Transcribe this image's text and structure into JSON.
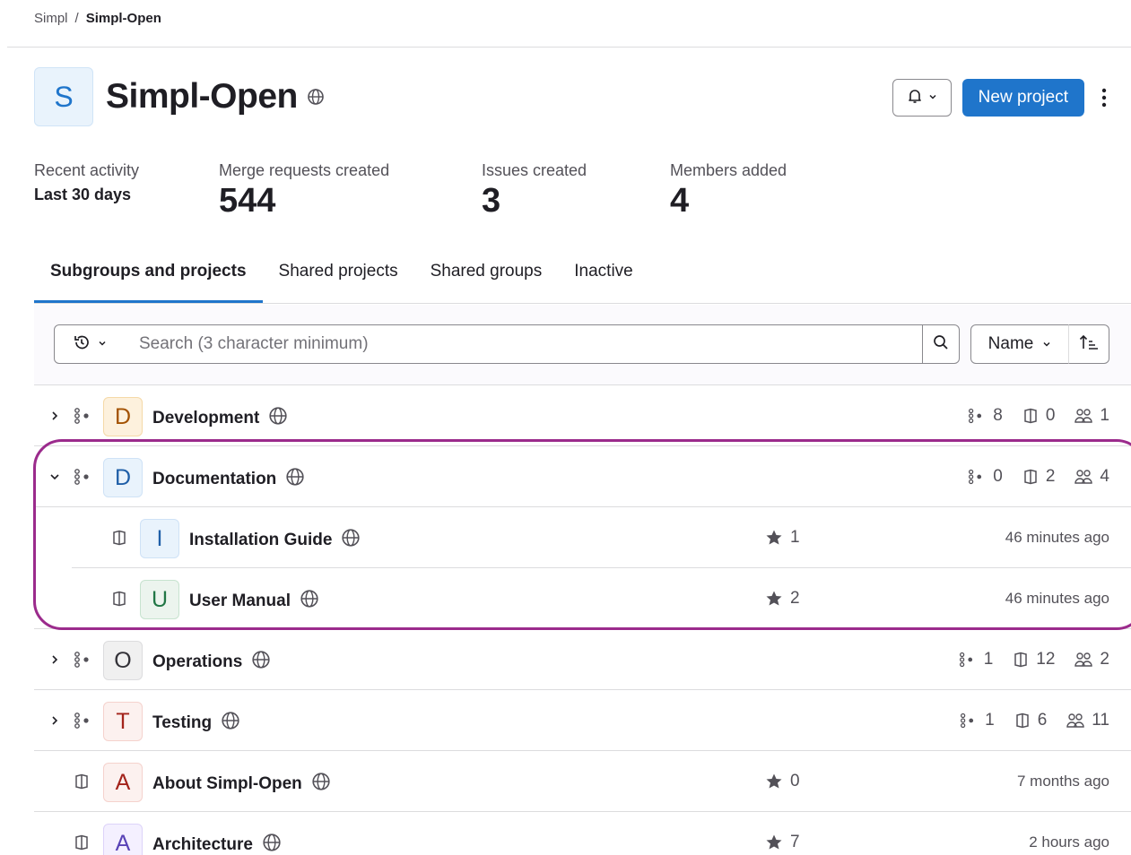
{
  "breadcrumb": {
    "parent": "Simpl",
    "separator": "/",
    "current": "Simpl-Open"
  },
  "group": {
    "avatar_letter": "S",
    "title": "Simpl-Open",
    "visibility_icon": "globe-icon"
  },
  "header_actions": {
    "new_project_label": "New project"
  },
  "stats": {
    "recent_activity_label": "Recent activity",
    "recent_activity_period": "Last 30 days",
    "merge_requests_label": "Merge requests created",
    "merge_requests_value": "544",
    "issues_label": "Issues created",
    "issues_value": "3",
    "members_label": "Members added",
    "members_value": "4"
  },
  "tabs": [
    {
      "label": "Subgroups and projects",
      "active": true
    },
    {
      "label": "Shared projects",
      "active": false
    },
    {
      "label": "Shared groups",
      "active": false
    },
    {
      "label": "Inactive",
      "active": false
    }
  ],
  "filter": {
    "search_placeholder": "Search (3 character minimum)",
    "sort_label": "Name"
  },
  "rows": [
    {
      "kind": "subgroup",
      "letter": "D",
      "name": "Development",
      "subgroups": "8",
      "projects": "0",
      "members": "1",
      "expanded": false
    },
    {
      "kind": "subgroup",
      "letter": "D",
      "name": "Documentation",
      "subgroups": "0",
      "projects": "2",
      "members": "4",
      "expanded": true
    },
    {
      "kind": "project",
      "letter": "I",
      "name": "Installation Guide",
      "stars": "1",
      "updated": "46 minutes ago"
    },
    {
      "kind": "project",
      "letter": "U",
      "name": "User Manual",
      "stars": "2",
      "updated": "46 minutes ago"
    },
    {
      "kind": "subgroup",
      "letter": "O",
      "name": "Operations",
      "subgroups": "1",
      "projects": "12",
      "members": "2",
      "expanded": false
    },
    {
      "kind": "subgroup",
      "letter": "T",
      "name": "Testing",
      "subgroups": "1",
      "projects": "6",
      "members": "11",
      "expanded": false
    },
    {
      "kind": "project",
      "letter": "A",
      "name": "About Simpl-Open",
      "stars": "0",
      "updated": "7 months ago"
    },
    {
      "kind": "project",
      "letter": "A",
      "name": "Architecture",
      "stars": "7",
      "updated": "2 hours ago"
    }
  ],
  "colors": {
    "accent": "#1f75cb",
    "highlight": "#9b2b8c",
    "avatar_orange_bg": "#fdf1dd",
    "avatar_blue_bg": "#e9f3fc",
    "avatar_green_bg": "#ecf4ee",
    "avatar_gray_bg": "#f0f0f0",
    "avatar_red_bg": "#fcf1ef",
    "avatar_purple_bg": "#f4f0ff"
  }
}
